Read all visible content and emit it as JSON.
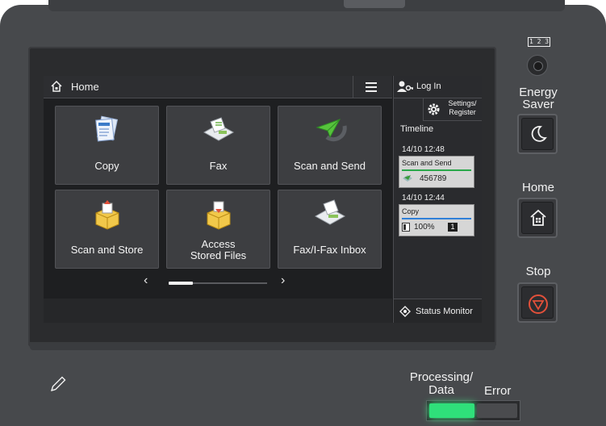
{
  "screen": {
    "header": {
      "title": "Home"
    },
    "tiles": [
      {
        "label": "Copy"
      },
      {
        "label": "Fax"
      },
      {
        "label": "Scan and Send"
      },
      {
        "label": "Scan and Store"
      },
      {
        "label": "Access\nStored Files",
        "line1": "Access",
        "line2": "Stored Files"
      },
      {
        "label": "Fax/I-Fax Inbox"
      }
    ],
    "pager": {
      "prev": "‹",
      "next": "›",
      "page": 1,
      "pages": 4
    },
    "side": {
      "login": "Log In",
      "settings_line1": "Settings/",
      "settings_line2": "Register",
      "timeline_title": "Timeline",
      "jobs": [
        {
          "time": "14/10 12:48",
          "title": "Scan and Send",
          "value": "456789",
          "bar_color": "#2aa84a"
        },
        {
          "time": "14/10 12:44",
          "title": "Copy",
          "value": "100%",
          "badge": "1",
          "bar_color": "#2f7fd8"
        }
      ],
      "status_monitor": "Status Monitor"
    }
  },
  "hardware": {
    "counter_label": "1 2 3",
    "energy_saver_line1": "Energy",
    "energy_saver_line2": "Saver",
    "home_label": "Home",
    "stop_label": "Stop",
    "processing_line1": "Processing/",
    "processing_line2": "Data",
    "error_label": "Error"
  },
  "colors": {
    "stop_accent": "#e2503a",
    "processing_led": "#2fe07a"
  }
}
